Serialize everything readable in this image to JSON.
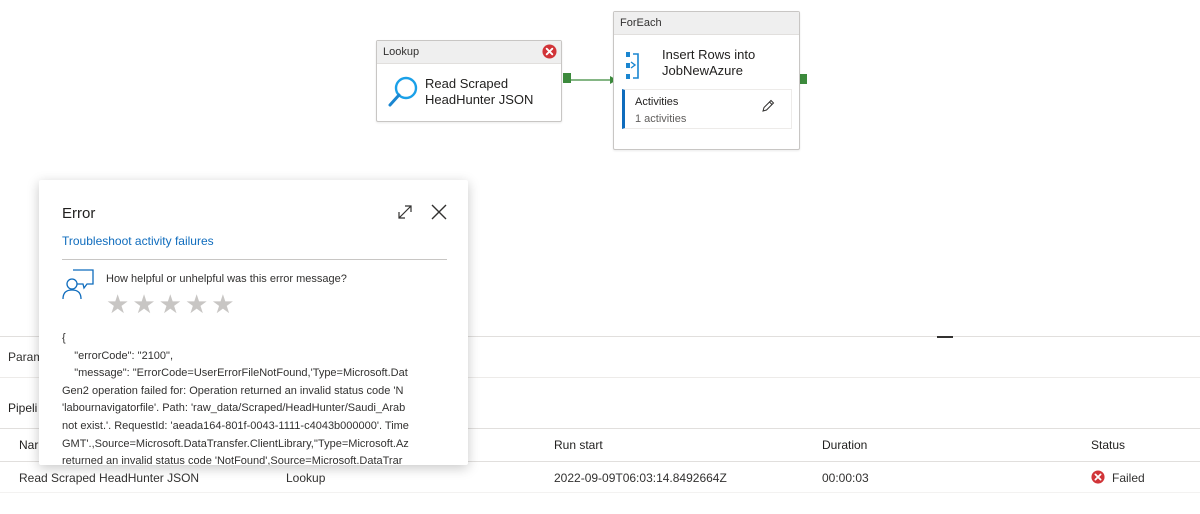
{
  "canvas": {
    "lookup": {
      "header": "Lookup",
      "title_line1": "Read Scraped",
      "title_line2": "HeadHunter JSON"
    },
    "foreach": {
      "header": "ForEach",
      "title_line1": "Insert Rows into",
      "title_line2": "JobNewAzure",
      "activities_label": "Activities",
      "activities_count": "1 activities"
    }
  },
  "bottom_panel": {
    "tab_parameters": "Param",
    "pipeline_title": "Pipeli",
    "columns": [
      "Nar",
      "Run start",
      "Duration",
      "Status"
    ],
    "rows": [
      {
        "name": "Read Scraped HeadHunter JSON",
        "type": "Lookup",
        "run_start": "2022-09-09T06:03:14.8492664Z",
        "duration": "00:00:03",
        "status": "Failed"
      }
    ]
  },
  "error_panel": {
    "title": "Error",
    "troubleshoot_link": "Troubleshoot activity failures",
    "feedback_question": "How helpful or unhelpful was this error message?",
    "stars": 5,
    "json_lines": [
      "{",
      "    \"errorCode\": \"2100\",",
      "    \"message\": \"ErrorCode=UserErrorFileNotFound,'Type=Microsoft.Dat",
      "Gen2 operation failed for: Operation returned an invalid status code 'N",
      "'labournavigatorfile'. Path: 'raw_data/Scraped/HeadHunter/Saudi_Arab",
      "not exist.'. RequestId: 'aeada164-801f-0043-1111-c4043b000000'. Time",
      "GMT'.,Source=Microsoft.DataTransfer.ClientLibrary,''Type=Microsoft.Az",
      "returned an invalid status code 'NotFound',Source=Microsoft.DataTrar"
    ]
  },
  "colors": {
    "accent": "#0f6cbd",
    "error": "#d13438",
    "success_port": "#3c8a3c"
  },
  "icons": {
    "lookup": "magnifier-icon",
    "foreach": "foreach-icon",
    "error": "error-circle-icon",
    "edit": "pencil-icon",
    "expand": "expand-icon",
    "close": "close-icon",
    "feedback": "feedback-person-icon"
  }
}
